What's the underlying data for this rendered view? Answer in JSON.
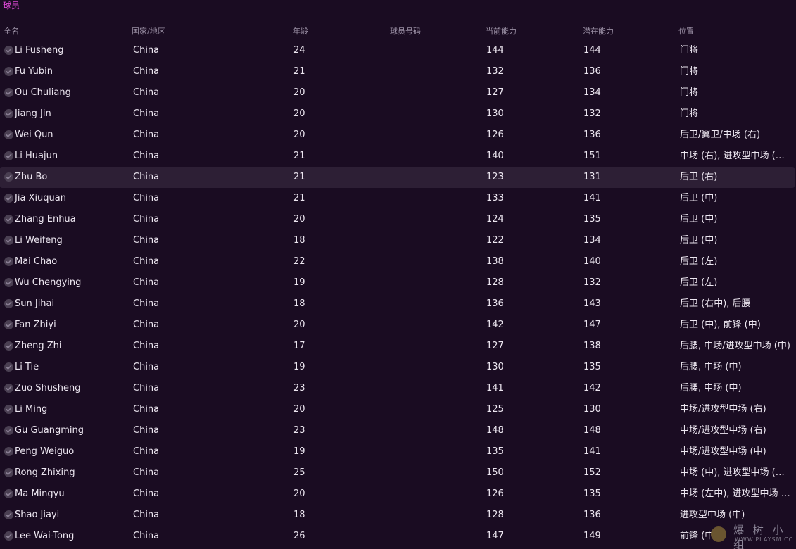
{
  "panel": {
    "title": "球员"
  },
  "columns": {
    "name": "全名",
    "nationality": "国家/地区",
    "age": "年龄",
    "squad_number": "球员号码",
    "current_ability": "当前能力",
    "potential_ability": "潜在能力",
    "position": "位置"
  },
  "players": [
    {
      "name": "Li Fusheng",
      "nationality": "China",
      "age": "24",
      "ca": "144",
      "pa": "144",
      "position": "门将"
    },
    {
      "name": "Fu Yubin",
      "nationality": "China",
      "age": "21",
      "ca": "132",
      "pa": "136",
      "position": "门将"
    },
    {
      "name": "Ou Chuliang",
      "nationality": "China",
      "age": "20",
      "ca": "127",
      "pa": "134",
      "position": "门将"
    },
    {
      "name": "Jiang Jin",
      "nationality": "China",
      "age": "20",
      "ca": "130",
      "pa": "132",
      "position": "门将"
    },
    {
      "name": "Wei Qun",
      "nationality": "China",
      "age": "20",
      "ca": "126",
      "pa": "136",
      "position": "后卫/翼卫/中场 (右)"
    },
    {
      "name": "Li Huajun",
      "nationality": "China",
      "age": "21",
      "ca": "140",
      "pa": "151",
      "position": "中场 (右), 进攻型中场 (右左..."
    },
    {
      "name": "Zhu Bo",
      "nationality": "China",
      "age": "21",
      "ca": "123",
      "pa": "131",
      "position": "后卫 (右)",
      "selected": true
    },
    {
      "name": "Jia Xiuquan",
      "nationality": "China",
      "age": "21",
      "ca": "133",
      "pa": "141",
      "position": "后卫 (中)"
    },
    {
      "name": "Zhang Enhua",
      "nationality": "China",
      "age": "20",
      "ca": "124",
      "pa": "135",
      "position": "后卫 (中)"
    },
    {
      "name": "Li Weifeng",
      "nationality": "China",
      "age": "18",
      "ca": "122",
      "pa": "134",
      "position": "后卫 (中)"
    },
    {
      "name": "Mai Chao",
      "nationality": "China",
      "age": "22",
      "ca": "138",
      "pa": "140",
      "position": "后卫 (左)"
    },
    {
      "name": "Wu Chengying",
      "nationality": "China",
      "age": "19",
      "ca": "128",
      "pa": "132",
      "position": "后卫 (左)"
    },
    {
      "name": "Sun Jihai",
      "nationality": "China",
      "age": "18",
      "ca": "136",
      "pa": "143",
      "position": "后卫 (右中), 后腰"
    },
    {
      "name": "Fan Zhiyi",
      "nationality": "China",
      "age": "20",
      "ca": "142",
      "pa": "147",
      "position": "后卫 (中), 前锋 (中)"
    },
    {
      "name": "Zheng Zhi",
      "nationality": "China",
      "age": "17",
      "ca": "127",
      "pa": "138",
      "position": "后腰, 中场/进攻型中场 (中)"
    },
    {
      "name": "Li Tie",
      "nationality": "China",
      "age": "19",
      "ca": "130",
      "pa": "135",
      "position": "后腰, 中场 (中)"
    },
    {
      "name": "Zuo Shusheng",
      "nationality": "China",
      "age": "23",
      "ca": "141",
      "pa": "142",
      "position": "后腰, 中场 (中)"
    },
    {
      "name": "Li Ming",
      "nationality": "China",
      "age": "20",
      "ca": "125",
      "pa": "130",
      "position": "中场/进攻型中场 (右)"
    },
    {
      "name": "Gu Guangming",
      "nationality": "China",
      "age": "23",
      "ca": "148",
      "pa": "148",
      "position": "中场/进攻型中场 (右)"
    },
    {
      "name": "Peng Weiguo",
      "nationality": "China",
      "age": "19",
      "ca": "135",
      "pa": "141",
      "position": "中场/进攻型中场 (中)"
    },
    {
      "name": "Rong Zhixing",
      "nationality": "China",
      "age": "25",
      "ca": "150",
      "pa": "152",
      "position": "中场 (中), 进攻型中场 (左),..."
    },
    {
      "name": "Ma Mingyu",
      "nationality": "China",
      "age": "20",
      "ca": "126",
      "pa": "135",
      "position": "中场 (左中), 进攻型中场 (左)"
    },
    {
      "name": "Shao Jiayi",
      "nationality": "China",
      "age": "18",
      "ca": "128",
      "pa": "136",
      "position": "进攻型中场 (中)"
    },
    {
      "name": "Lee Wai-Tong",
      "nationality": "China",
      "age": "26",
      "ca": "147",
      "pa": "149",
      "position": "前锋 (中)"
    }
  ],
  "icons": {
    "row_check": "check-circle-icon",
    "watermark_logo": "watermark-logo-icon"
  },
  "colors": {
    "background": "#1a0c22",
    "title_accent": "#e04ad8",
    "selected_row": "#2d1f35"
  },
  "watermark": {
    "text": "爆 树 小 组",
    "sub": "WWW.PLAYSM.CC"
  }
}
